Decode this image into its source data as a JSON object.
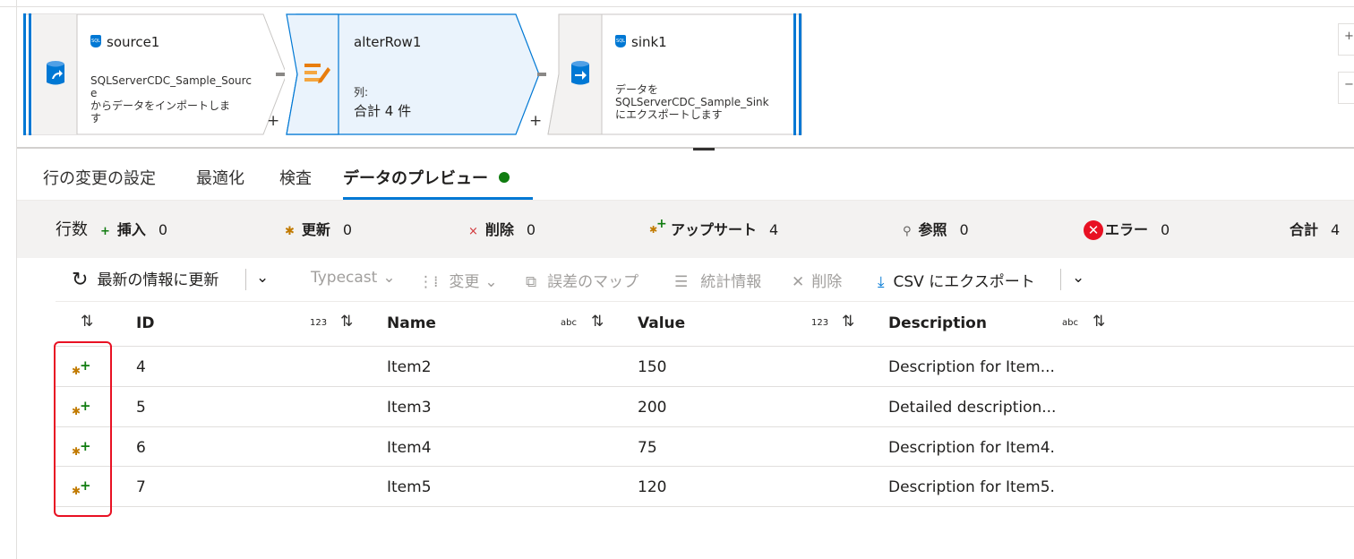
{
  "nodes": {
    "source": {
      "title": "source1",
      "desc_lines": [
        "SQLServerCDC_Sample_Sourc",
        "e",
        "からデータをインポートしま",
        "す"
      ],
      "plus": "+"
    },
    "alter": {
      "title": "alterRow1",
      "col_label": "列:",
      "total": "合計 4 件",
      "plus": "+"
    },
    "sink": {
      "title": "sink1",
      "desc_lines": [
        "データを",
        "SQLServerCDC_Sample_Sink",
        "にエクスポートします"
      ]
    }
  },
  "tabs": [
    {
      "label": "行の変更の設定"
    },
    {
      "label": "最適化"
    },
    {
      "label": "検査"
    },
    {
      "label": "データのプレビュー",
      "active": true
    }
  ],
  "stats": {
    "rows_label": "行数",
    "insert": {
      "label": "挿入",
      "value": "0"
    },
    "update": {
      "label": "更新",
      "value": "0"
    },
    "delete": {
      "label": "削除",
      "value": "0"
    },
    "upsert": {
      "label": "アップサート",
      "value": "4"
    },
    "lookup": {
      "label": "参照",
      "value": "0"
    },
    "error": {
      "label": "エラー",
      "value": "0"
    },
    "total": {
      "label": "合計",
      "value": "4"
    }
  },
  "toolbar": {
    "refresh": "最新の情報に更新",
    "typecast": "Typecast",
    "modify": "変更",
    "map_drifted": "誤差のマップ",
    "statistics": "統計情報",
    "remove": "削除",
    "export_csv": "CSV にエクスポート"
  },
  "table": {
    "columns": [
      {
        "name": "ID",
        "type": "123"
      },
      {
        "name": "Name",
        "type": "abc"
      },
      {
        "name": "Value",
        "type": "123"
      },
      {
        "name": "Description",
        "type": "abc"
      }
    ],
    "rows": [
      {
        "id": "4",
        "name": "Item2",
        "value": "150",
        "description": "Description for Item..."
      },
      {
        "id": "5",
        "name": "Item3",
        "value": "200",
        "description": "Detailed description..."
      },
      {
        "id": "6",
        "name": "Item4",
        "value": "75",
        "description": "Description for Item4."
      },
      {
        "id": "7",
        "name": "Item5",
        "value": "120",
        "description": "Description for Item5."
      }
    ]
  },
  "colors": {
    "accent": "#0078d4",
    "success": "#107c10",
    "error": "#e81123",
    "highlight": "#e81123"
  }
}
